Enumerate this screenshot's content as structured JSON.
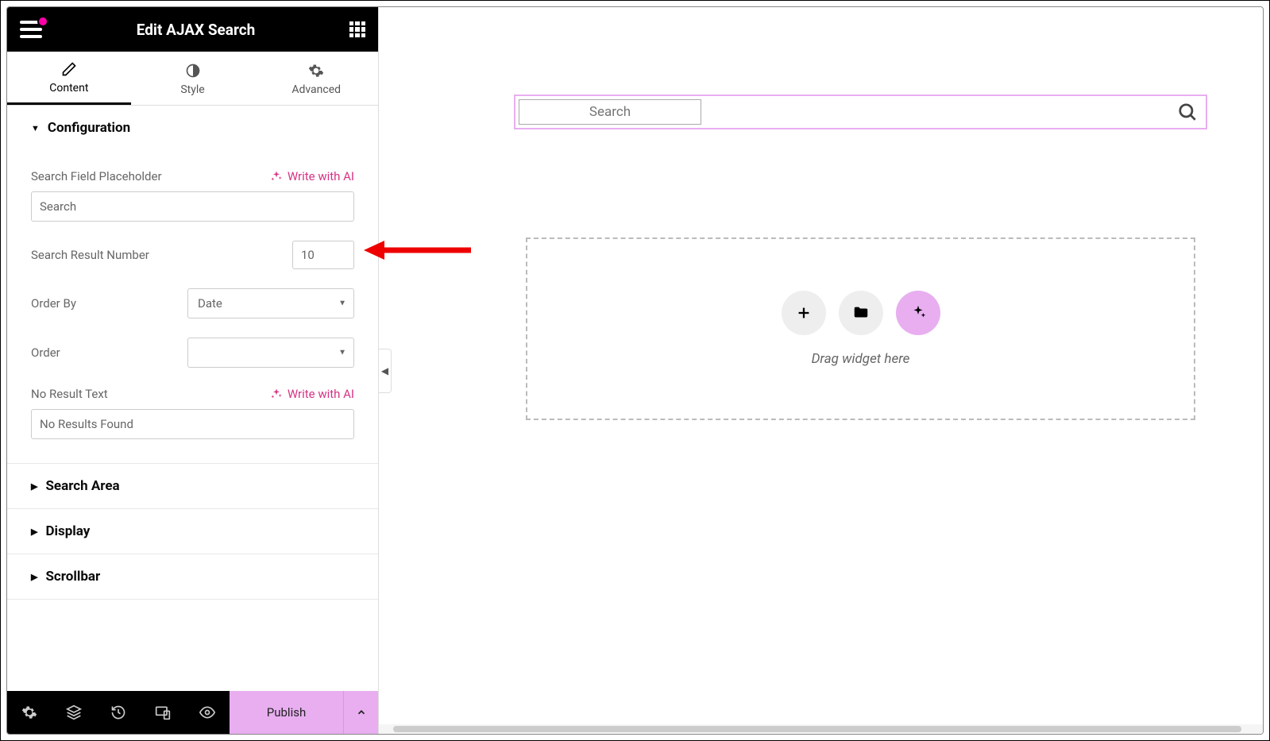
{
  "header": {
    "title": "Edit AJAX Search"
  },
  "tabs": {
    "content": "Content",
    "style": "Style",
    "advanced": "Advanced"
  },
  "sections": {
    "configuration": {
      "title": "Configuration",
      "fields": {
        "placeholder_label": "Search Field Placeholder",
        "placeholder_value": "Search",
        "ai_link": "Write with AI",
        "result_number_label": "Search Result Number",
        "result_number_value": "10",
        "order_by_label": "Order By",
        "order_by_value": "Date",
        "order_label": "Order",
        "order_value": "",
        "no_result_label": "No Result Text",
        "no_result_value": "No Results Found"
      }
    },
    "search_area": {
      "title": "Search Area"
    },
    "display": {
      "title": "Display"
    },
    "scrollbar": {
      "title": "Scrollbar"
    }
  },
  "footer": {
    "publish": "Publish"
  },
  "canvas": {
    "search_placeholder": "Search",
    "drop_text": "Drag widget here"
  }
}
